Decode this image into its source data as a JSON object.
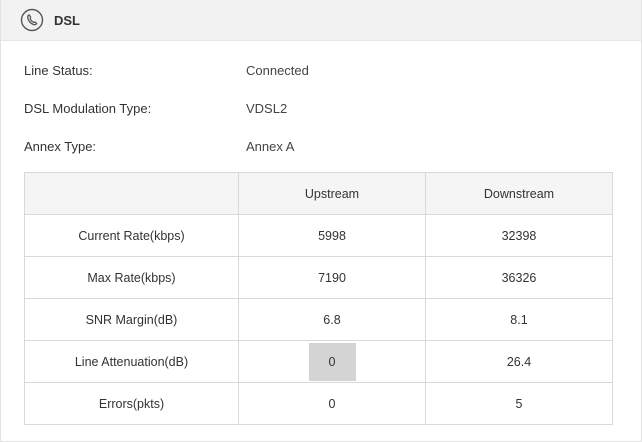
{
  "header": {
    "title": "DSL",
    "icon": "phone-icon"
  },
  "info": {
    "line_status": {
      "label": "Line Status:",
      "value": "Connected"
    },
    "modulation": {
      "label": "DSL Modulation Type:",
      "value": "VDSL2"
    },
    "annex": {
      "label": "Annex Type:",
      "value": "Annex A"
    }
  },
  "table": {
    "columns": [
      "",
      "Upstream",
      "Downstream"
    ],
    "rows": [
      {
        "label": "Current Rate(kbps)",
        "upstream": "5998",
        "downstream": "32398"
      },
      {
        "label": "Max Rate(kbps)",
        "upstream": "7190",
        "downstream": "36326"
      },
      {
        "label": "SNR Margin(dB)",
        "upstream": "6.8",
        "downstream": "8.1"
      },
      {
        "label": "Line Attenuation(dB)",
        "upstream": "0",
        "downstream": "26.4"
      },
      {
        "label": "Errors(pkts)",
        "upstream": "0",
        "downstream": "5"
      }
    ]
  },
  "colors": {
    "header_bg": "#f2f2f2",
    "border": "#d9d9d9",
    "highlight": "#d4d4d4"
  }
}
